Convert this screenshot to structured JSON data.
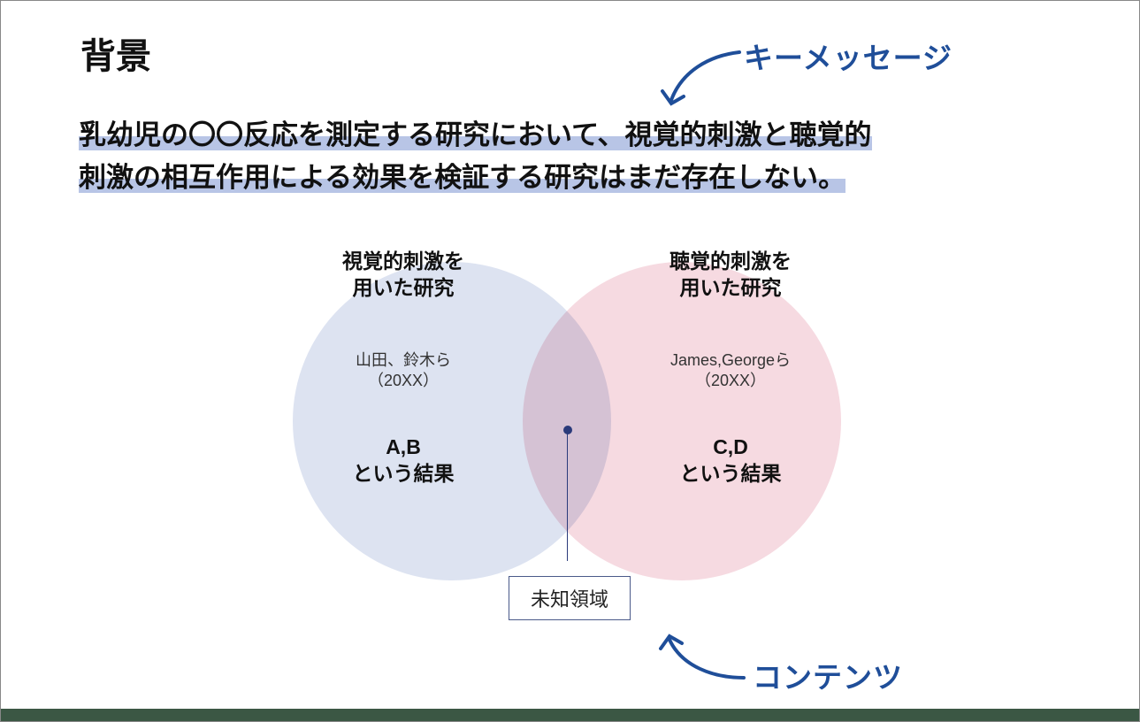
{
  "slide": {
    "title": "背景",
    "key_message_line1": "乳幼児の〇〇反応を測定する研究において、視覚的刺激と聴覚的",
    "key_message_line2": "刺激の相互作用による効果を検証する研究はまだ存在しない。"
  },
  "annotations": {
    "top": "キーメッセージ",
    "bottom": "コンテンツ"
  },
  "venn": {
    "left": {
      "title_l1": "視覚的刺激を",
      "title_l2": "用いた研究",
      "cite_l1": "山田、鈴木ら",
      "cite_l2": "（20XX）",
      "result_l1": "A,B",
      "result_l2": "という結果"
    },
    "right": {
      "title_l1": "聴覚的刺激を",
      "title_l2": "用いた研究",
      "cite_l1": "James,Georgeら",
      "cite_l2": "（20XX）",
      "result_l1": "C,D",
      "result_l2": "という結果"
    },
    "center_label": "未知領域"
  },
  "colors": {
    "accent": "#1f4e99",
    "highlight": "#b8c5e6",
    "venn_left": "#dde3f1",
    "venn_right": "#f6dae1",
    "footer": "#3b5744"
  }
}
